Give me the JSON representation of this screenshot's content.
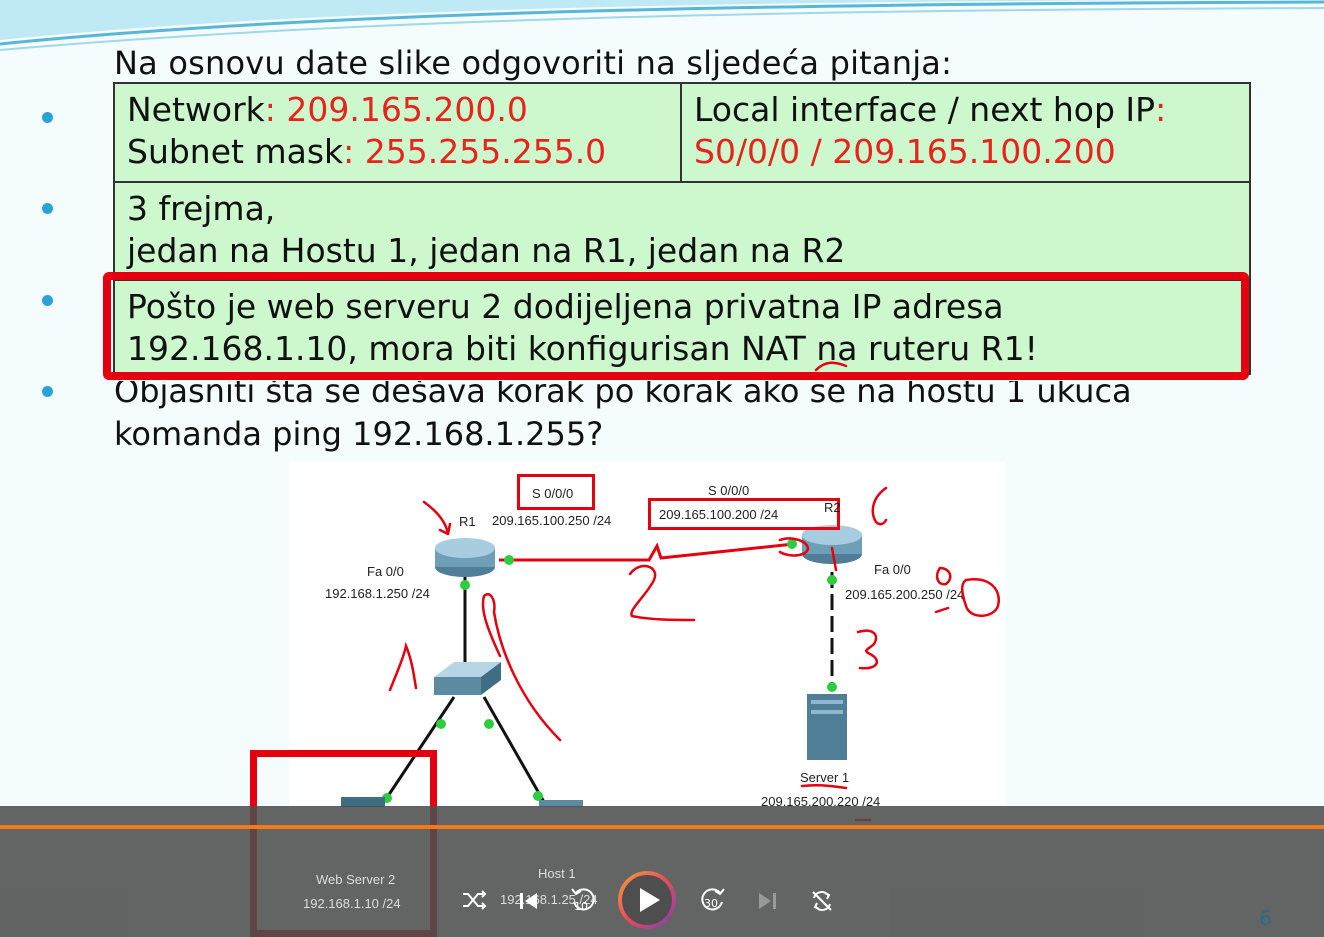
{
  "slide": {
    "question": "Na osnovu date slike odgovoriti na sljedeća pitanja:",
    "answer1": {
      "network_label": "Network",
      "network_value": ": 209.165.200.0",
      "mask_label": "Subnet mask",
      "mask_value": ": 255.255.255.0",
      "iface_label": "Local interface / next hop IP",
      "iface_colon": ":",
      "iface_value": "S0/0/0 / 209.165.100.200"
    },
    "answer2": {
      "line1": "3 frejma,",
      "line2": "jedan na Hostu 1, jedan na R1, jedan na R2"
    },
    "answer3": {
      "line1": "Pošto je web serveru 2 dodijeljena privatna IP adresa",
      "line2": "192.168.1.10, mora biti konfigurisan NAT na ruteru R1!"
    },
    "question4": {
      "line1": "Objasniti šta se dešava korak po korak ako se na hostu 1 ukuca",
      "line2": "komanda ping 192.168.1.255?"
    },
    "page_number": "6"
  },
  "diagram": {
    "r1_name": "R1",
    "r1_serial": "S 0/0/0",
    "r1_serial_ip": "209.165.100.250 /24",
    "r1_fa": "Fa 0/0",
    "r1_fa_ip": "192.168.1.250 /24",
    "r2_name": "R2",
    "r2_serial": "S 0/0/0",
    "r2_serial_ip": "209.165.100.200 /24",
    "r2_fa": "Fa 0/0",
    "r2_fa_ip": "209.165.200.250 /24",
    "server1_name": "Server 1",
    "server1_ip": "209.165.200.220 /24",
    "webserver2_name": "Web Server 2",
    "webserver2_ip": "192.168.1.10 /24",
    "host1_name": "Host 1",
    "host1_ip": "192.168.1.25 /24"
  },
  "player": {
    "shuffle_icon": "shuffle-icon",
    "previous_icon": "skip-previous-icon",
    "rewind_label": "10",
    "play_icon": "play-icon",
    "forward_label": "30",
    "next_icon": "skip-next-icon",
    "repeat_icon": "repeat-off-icon",
    "accent_color": "#f27a1a"
  }
}
